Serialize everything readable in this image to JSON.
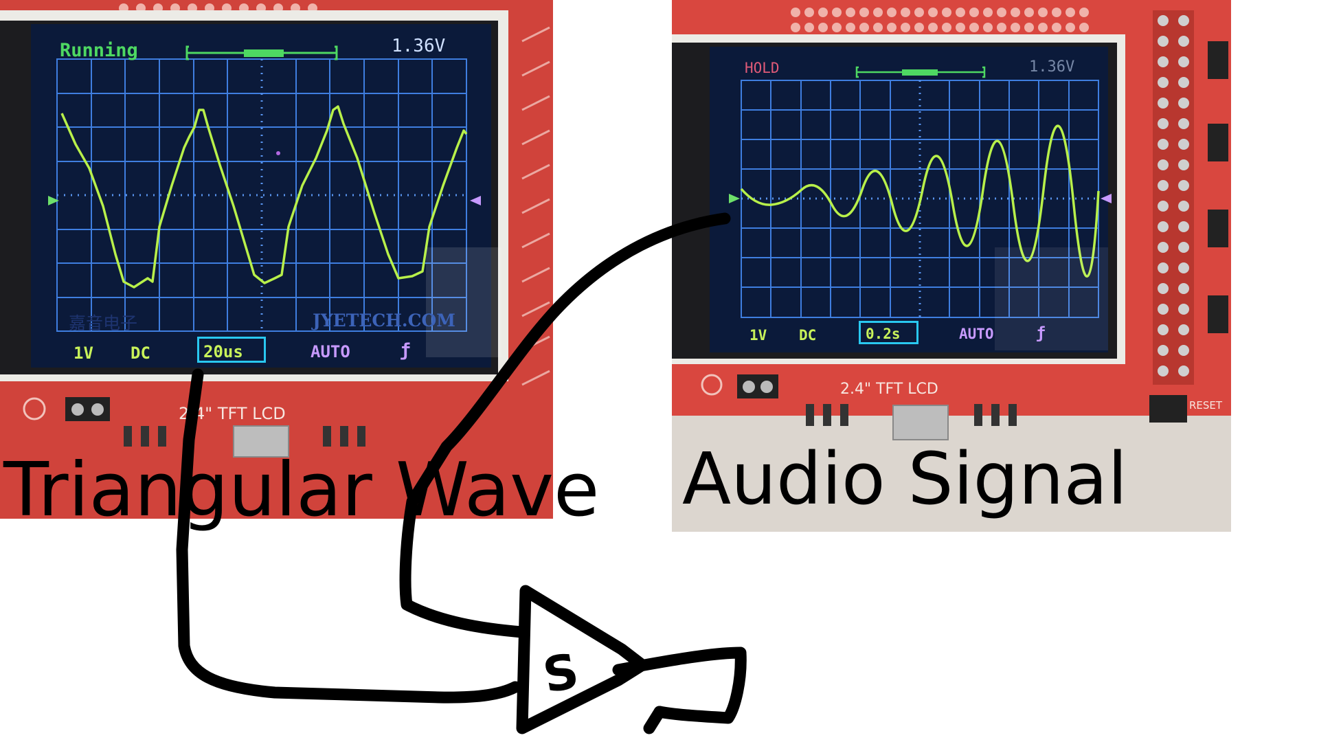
{
  "left_panel": {
    "status": "Running",
    "voltage": "1.36V",
    "volts_per_div": "1V",
    "coupling": "DC",
    "timebase": "20us",
    "trigger_mode": "AUTO",
    "trigger_edge": "ƒ",
    "watermark_cn": "嘉音电子",
    "watermark": "JYETECH.COM",
    "board_label": "2.4\" TFT  LCD",
    "caption": "Triangular Wave"
  },
  "right_panel": {
    "status": "HOLD",
    "voltage": "1.36V",
    "volts_per_div": "1V",
    "coupling": "DC",
    "timebase": "0.2s",
    "trigger_mode": "AUTO",
    "trigger_edge": "ƒ",
    "board_label": "2.4\" TFT  LCD",
    "reset_label": "RESET",
    "caption": "Audio Signal"
  },
  "colors": {
    "pcb": "#d9473f",
    "lcd_bg": "#0b1a3a",
    "grid": "#3f7ee0",
    "trace": "#b8f04a",
    "status_running": "#4ed862",
    "status_hold": "#e05a78",
    "menu_green": "#c8f25a",
    "menu_violet": "#c79aff",
    "timebase_border": "#29c8f0",
    "ink": "#000000"
  },
  "icons": [
    "amplifier-sketch",
    "trigger-marker",
    "ground-marker"
  ]
}
